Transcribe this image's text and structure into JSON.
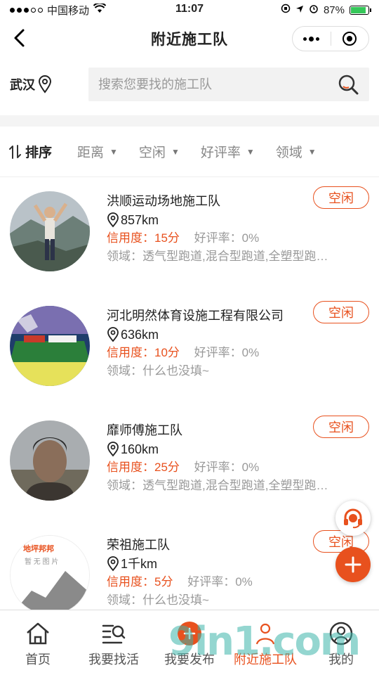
{
  "status_bar": {
    "carrier": "中国移动",
    "time": "11:07",
    "battery": "87%",
    "battery_level": 0.87
  },
  "nav": {
    "title": "附近施工队"
  },
  "search": {
    "city": "武汉",
    "placeholder": "搜索您要找的施工队"
  },
  "filters": {
    "sort_label": "排序",
    "items": [
      "距离",
      "空闲",
      "好评率",
      "领域"
    ]
  },
  "teams": [
    {
      "name": "洪顺运动场地施工队",
      "distance": "857km",
      "credit": "信用度：15分",
      "rating": "好评率：0%",
      "domain": "领域：透气型跑道,混合型跑道,全塑型跑…",
      "status": "空闲"
    },
    {
      "name": "河北明然体育设施工程有限公司",
      "distance": "636km",
      "credit": "信用度：10分",
      "rating": "好评率：0%",
      "domain": "领域：什么也没填~",
      "status": "空闲"
    },
    {
      "name": "靡师傅施工队",
      "distance": "160km",
      "credit": "信用度：25分",
      "rating": "好评率：0%",
      "domain": "领域：透气型跑道,混合型跑道,全塑型跑…",
      "status": "空闲"
    },
    {
      "name": "荣祖施工队",
      "distance": "1千km",
      "credit": "信用度：5分",
      "rating": "好评率：0%",
      "domain": "领域：什么也没填~",
      "status": "空闲",
      "avatar_brand": "地坪邦邦",
      "avatar_placeholder": "暂 无 图 片"
    }
  ],
  "tabs": [
    {
      "label": "首页",
      "icon": "home-icon"
    },
    {
      "label": "我要找活",
      "icon": "find-work-icon"
    },
    {
      "label": "我要发布",
      "icon": "publish-icon"
    },
    {
      "label": "附近施工队",
      "icon": "nearby-team-icon"
    },
    {
      "label": "我的",
      "icon": "profile-icon"
    }
  ],
  "watermark": "9in1.com",
  "colors": {
    "accent": "#e8511e",
    "muted": "#999999"
  }
}
